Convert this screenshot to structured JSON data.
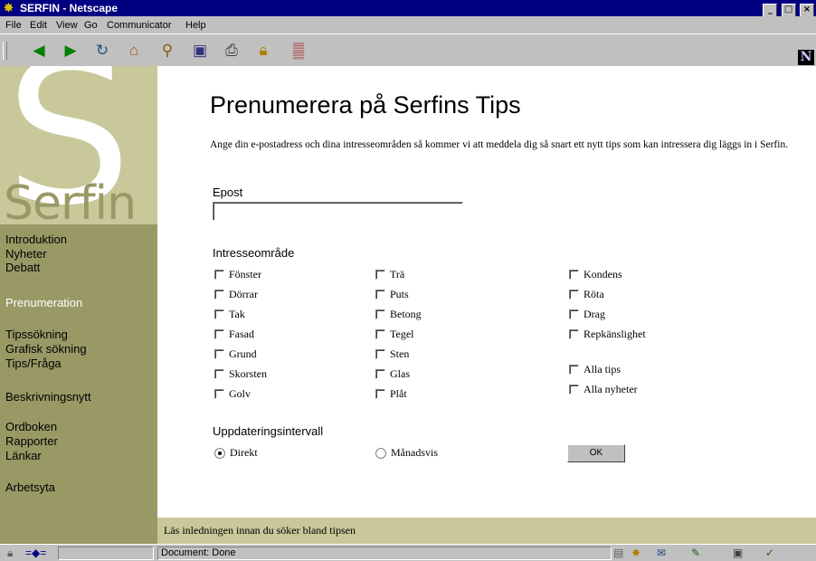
{
  "window": {
    "title": "SERFIN - Netscape",
    "buttons": {
      "minimize": "_",
      "maximize": "□",
      "close": "×"
    }
  },
  "menu": [
    "File",
    "Edit",
    "View",
    "Go",
    "Communicator",
    "Help"
  ],
  "toolbar_icons": [
    "back-icon",
    "forward-icon",
    "reload-icon",
    "home-icon",
    "search-icon",
    "guide-icon",
    "print-icon",
    "security-icon",
    "stop-icon"
  ],
  "netscape_logo": "N",
  "sidebar": {
    "logo_letter": "S",
    "logo_text": "Serfin",
    "nav": [
      "Introduktion",
      "Nyheter",
      "Debatt",
      "Prenumeration",
      "Tipssökning",
      "Grafisk sökning",
      "Tips/Fråga",
      "Beskrivningsnytt",
      "Ordboken",
      "Rapporter",
      "Länkar",
      "Arbetsyta"
    ],
    "active": "Prenumeration"
  },
  "main": {
    "title": "Prenumerera på Serfins Tips",
    "intro": "Ange din e-postadress och dina intresseområden så kommer vi att meddela dig så snart ett nytt tips som kan intressera dig läggs in i Serfin.",
    "email_label": "Epost",
    "email_value": "",
    "interests_label": "Intresseområde",
    "col1": [
      "Fönster",
      "Dörrar",
      "Tak",
      "Fasad",
      "Grund",
      "Skorsten",
      "Golv"
    ],
    "col2": [
      "Trä",
      "Puts",
      "Betong",
      "Tegel",
      "Sten",
      "Glas",
      "Plåt"
    ],
    "col3": [
      "Kondens",
      "Röta",
      "Drag",
      "Repkänslighet"
    ],
    "col3b": [
      "Alla tips",
      "Alla nyheter"
    ],
    "interval_label": "Uppdateringsintervall",
    "radio1": "Direkt",
    "radio2": "Månadsvis",
    "radio_selected": "Direkt",
    "ok_label": "OK"
  },
  "footer": "Läs inledningen innan du söker bland tipsen",
  "status": "Document: Done"
}
